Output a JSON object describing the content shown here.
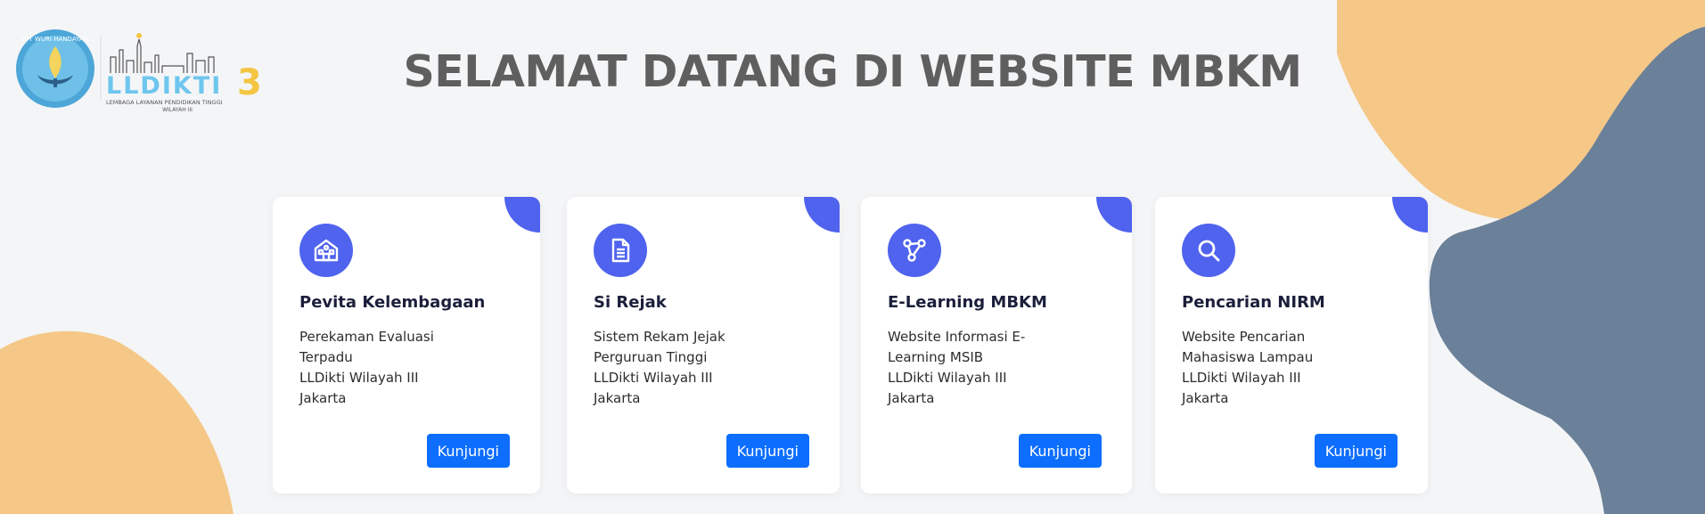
{
  "colors": {
    "accent": "#4f63ee",
    "button": "#0d6efd",
    "blob_orange": "#f5c888",
    "blob_slate": "#6b8099",
    "title": "#5f5f5f"
  },
  "header": {
    "title": "SELAMAT DATANG DI WEBSITE MBKM",
    "logo": {
      "brand": "LLDIKTI",
      "brand_number": "3",
      "subtitle": "LEMBAGA LAYANAN PENDIDIKAN TINGGI",
      "region": "WILAYAH III",
      "seal_text": "TUT WURI HANDAYANI"
    }
  },
  "cards": [
    {
      "icon": "school-building-icon",
      "title": "Pevita Kelembagaan",
      "desc": [
        "Perekaman Evaluasi",
        "Terpadu",
        "LLDikti Wilayah III",
        "Jakarta"
      ],
      "button": "Kunjungi"
    },
    {
      "icon": "document-icon",
      "title": "Si Rejak",
      "desc": [
        "Sistem Rekam Jejak",
        "Perguruan Tinggi",
        "LLDikti Wilayah III",
        "Jakarta"
      ],
      "button": "Kunjungi"
    },
    {
      "icon": "network-nodes-icon",
      "title": "E-Learning MBKM",
      "desc": [
        "Website Informasi E-",
        "Learning MSIB",
        "LLDikti Wilayah III",
        "Jakarta"
      ],
      "button": "Kunjungi"
    },
    {
      "icon": "search-icon",
      "title": "Pencarian NIRM",
      "desc": [
        "Website Pencarian",
        "Mahasiswa Lampau",
        "LLDikti Wilayah III",
        "Jakarta"
      ],
      "button": "Kunjungi"
    }
  ]
}
